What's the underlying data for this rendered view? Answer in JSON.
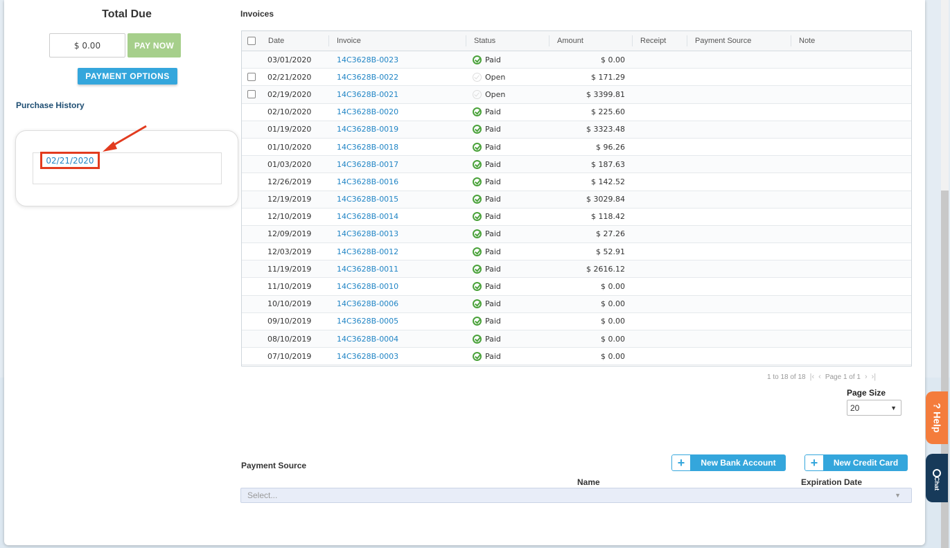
{
  "summary": {
    "total_due_label": "Total Due",
    "amount_value": "$ 0.00",
    "pay_now_label": "PAY NOW",
    "payment_options_label": "PAYMENT OPTIONS"
  },
  "purchase_history": {
    "title": "Purchase History",
    "selected_date": "02/21/2020"
  },
  "invoices": {
    "title": "Invoices",
    "columns": [
      "Date",
      "Invoice",
      "Status",
      "Amount",
      "Receipt",
      "Payment Source",
      "Note"
    ],
    "rows": [
      {
        "date": "03/01/2020",
        "invoice": "14C3628B-0023",
        "status": "Paid",
        "amount": "$ 0.00",
        "checkbox": false
      },
      {
        "date": "02/21/2020",
        "invoice": "14C3628B-0022",
        "status": "Open",
        "amount": "$ 171.29",
        "checkbox": true
      },
      {
        "date": "02/19/2020",
        "invoice": "14C3628B-0021",
        "status": "Open",
        "amount": "$ 3399.81",
        "checkbox": true
      },
      {
        "date": "02/10/2020",
        "invoice": "14C3628B-0020",
        "status": "Paid",
        "amount": "$ 225.60",
        "checkbox": false
      },
      {
        "date": "01/19/2020",
        "invoice": "14C3628B-0019",
        "status": "Paid",
        "amount": "$ 3323.48",
        "checkbox": false
      },
      {
        "date": "01/10/2020",
        "invoice": "14C3628B-0018",
        "status": "Paid",
        "amount": "$ 96.26",
        "checkbox": false
      },
      {
        "date": "01/03/2020",
        "invoice": "14C3628B-0017",
        "status": "Paid",
        "amount": "$ 187.63",
        "checkbox": false
      },
      {
        "date": "12/26/2019",
        "invoice": "14C3628B-0016",
        "status": "Paid",
        "amount": "$ 142.52",
        "checkbox": false
      },
      {
        "date": "12/19/2019",
        "invoice": "14C3628B-0015",
        "status": "Paid",
        "amount": "$ 3029.84",
        "checkbox": false
      },
      {
        "date": "12/10/2019",
        "invoice": "14C3628B-0014",
        "status": "Paid",
        "amount": "$ 118.42",
        "checkbox": false
      },
      {
        "date": "12/09/2019",
        "invoice": "14C3628B-0013",
        "status": "Paid",
        "amount": "$ 27.26",
        "checkbox": false
      },
      {
        "date": "12/03/2019",
        "invoice": "14C3628B-0012",
        "status": "Paid",
        "amount": "$ 52.91",
        "checkbox": false
      },
      {
        "date": "11/19/2019",
        "invoice": "14C3628B-0011",
        "status": "Paid",
        "amount": "$ 2616.12",
        "checkbox": false
      },
      {
        "date": "11/10/2019",
        "invoice": "14C3628B-0010",
        "status": "Paid",
        "amount": "$ 0.00",
        "checkbox": false
      },
      {
        "date": "10/10/2019",
        "invoice": "14C3628B-0006",
        "status": "Paid",
        "amount": "$ 0.00",
        "checkbox": false
      },
      {
        "date": "09/10/2019",
        "invoice": "14C3628B-0005",
        "status": "Paid",
        "amount": "$ 0.00",
        "checkbox": false
      },
      {
        "date": "08/10/2019",
        "invoice": "14C3628B-0004",
        "status": "Paid",
        "amount": "$ 0.00",
        "checkbox": false
      },
      {
        "date": "07/10/2019",
        "invoice": "14C3628B-0003",
        "status": "Paid",
        "amount": "$ 0.00",
        "checkbox": false
      }
    ]
  },
  "pager": {
    "range_text": "1 to 18 of 18",
    "page_text": "Page 1 of 1",
    "page_size_label": "Page Size",
    "page_size_value": "20"
  },
  "payment_source": {
    "title": "Payment Source",
    "new_bank_account_label": "New Bank Account",
    "new_credit_card_label": "New Credit Card",
    "name_col": "Name",
    "expiration_col": "Expiration Date",
    "select_placeholder": "Select..."
  },
  "side_tabs": {
    "help_label": "? Help",
    "chat_label": "Chat"
  },
  "colors": {
    "accent": "#34a6dc",
    "pay_now": "#a6cf8b",
    "paid_green": "#4aa23a",
    "link": "#2185c5",
    "highlight_red": "#e23b1f",
    "help_orange": "#f47c3c",
    "chat_navy": "#173a5a"
  }
}
